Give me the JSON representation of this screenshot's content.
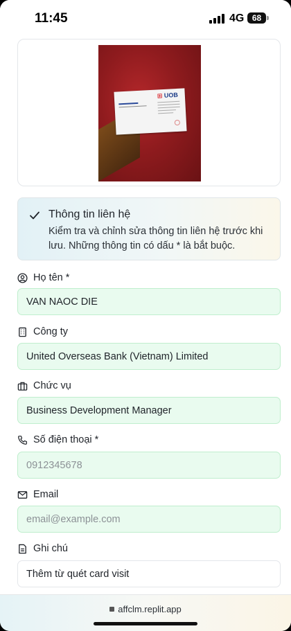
{
  "status_bar": {
    "time": "11:45",
    "network": "4G",
    "battery": "68"
  },
  "scanned_card": {
    "logo_text": "UOB",
    "logo_color": "#1b3b87",
    "photo_background": "red carpet"
  },
  "info_box": {
    "title": "Thông tin liên hệ",
    "description": "Kiểm tra và chỉnh sửa thông tin liên hệ trước khi lưu. Những thông tin có dấu * là bắt buộc."
  },
  "fields": {
    "name": {
      "label": "Họ tên *",
      "value": "VAN NAOC DIE",
      "icon": "user-circle-icon"
    },
    "company": {
      "label": "Công ty",
      "value": "United Overseas Bank (Vietnam) Limited",
      "icon": "building-icon"
    },
    "position": {
      "label": "Chức vụ",
      "value": "Business Development Manager",
      "icon": "briefcase-icon"
    },
    "phone": {
      "label": "Số điện thoại *",
      "value": "",
      "placeholder": "0912345678",
      "icon": "phone-icon"
    },
    "email": {
      "label": "Email",
      "value": "",
      "placeholder": "email@example.com",
      "icon": "mail-icon"
    },
    "note": {
      "label": "Ghi chú",
      "value": "Thêm từ quét card visit",
      "icon": "file-icon"
    }
  },
  "browser": {
    "url": "affclm.replit.app"
  },
  "colors": {
    "filled_field_bg": "#e9fbef",
    "filled_field_border": "#bfeecd"
  }
}
